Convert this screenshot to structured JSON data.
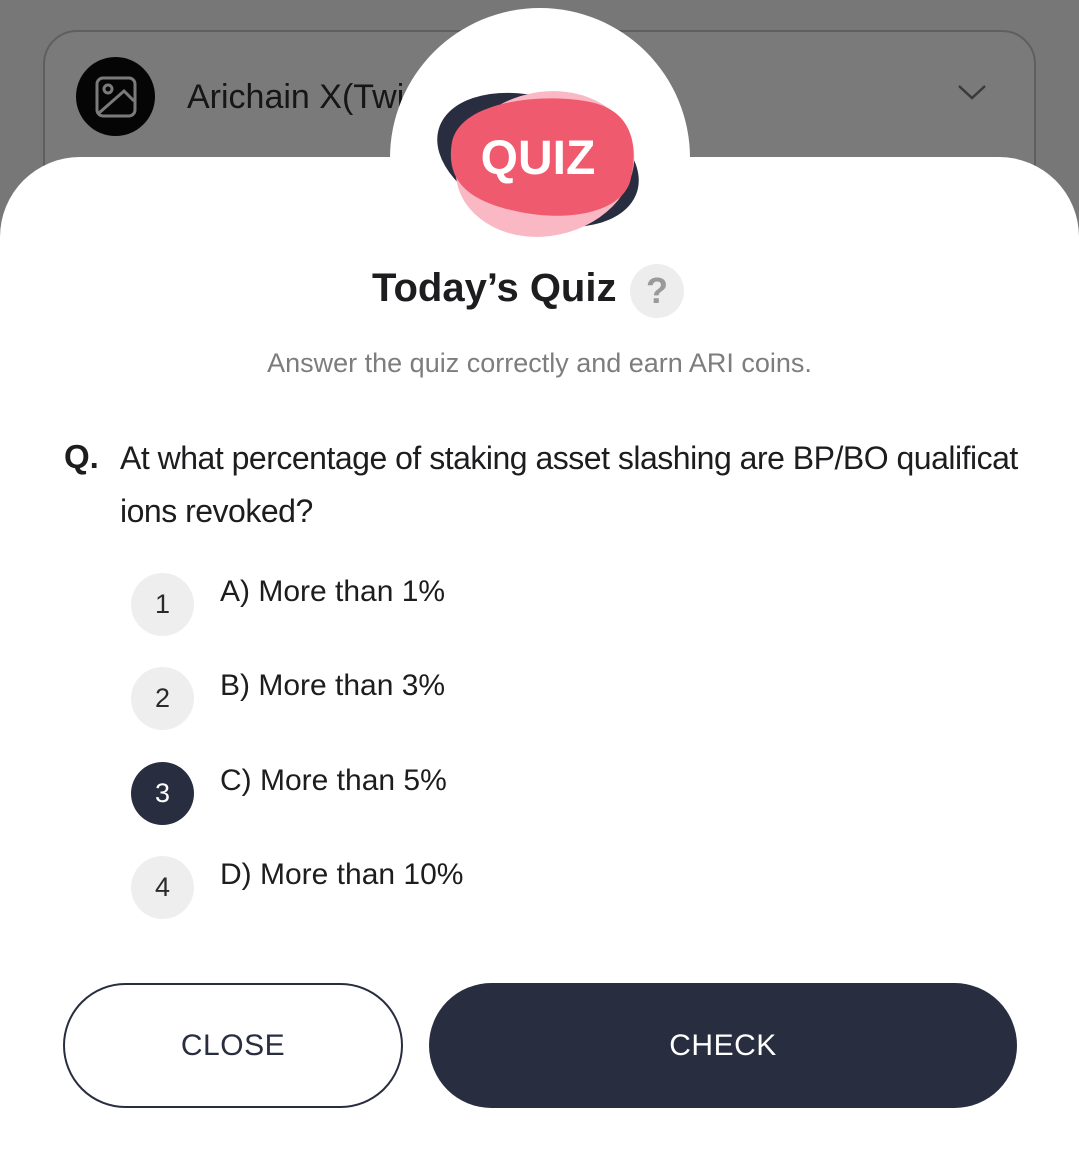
{
  "background": {
    "dropdown_label": "Arichain X(Twi",
    "image_icon": "image-icon",
    "chevron_icon": "chevron-down-icon"
  },
  "quiz": {
    "logo_text": "QUIZ",
    "title": "Today’s Quiz",
    "help_label": "?",
    "subtitle": "Answer the quiz correctly and earn ARI coins.",
    "question_mark": "Q.",
    "question": "At what percentage of staking asset slashing are BP/BO qualifications revoked?",
    "options": [
      {
        "number": "1",
        "label": "A) More than 1%",
        "selected": false
      },
      {
        "number": "2",
        "label": "B) More than 3%",
        "selected": false
      },
      {
        "number": "3",
        "label": "C) More than 5%",
        "selected": true
      },
      {
        "number": "4",
        "label": "D) More than 10%",
        "selected": false
      }
    ],
    "close_label": "CLOSE",
    "check_label": "CHECK"
  },
  "colors": {
    "primary": "#282d40",
    "accent_pink": "#f05a6e",
    "overlay": "#777777"
  }
}
